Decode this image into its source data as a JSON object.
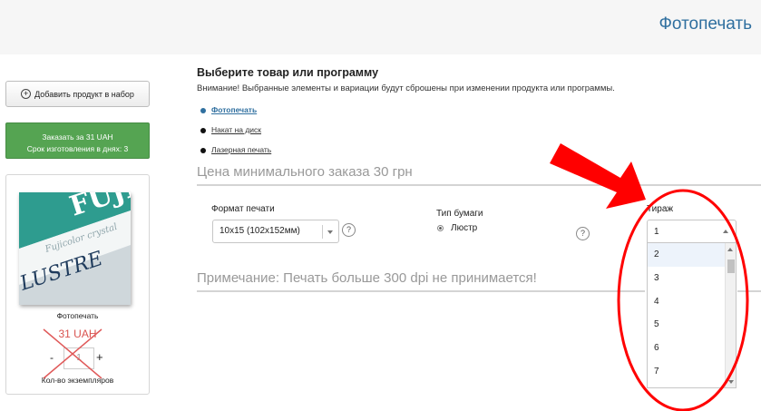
{
  "header": {
    "title": "Фотопечать"
  },
  "sidebar": {
    "add_product_label": "Добавить продукт в набор",
    "order": {
      "label": "Заказать за 31 UAH",
      "subtitle": "Срок изготовления в днях: 3"
    },
    "product": {
      "name": "Фотопечать",
      "price": "31 UAH",
      "quantity_value": "1",
      "quantity_minus": "-",
      "quantity_plus": "+",
      "quantity_label": "Кол-во экземпляров",
      "image_text": [
        "FUJI",
        "Fujicolor crystal",
        "LUSTRE"
      ]
    }
  },
  "main": {
    "heading": "Выберите товар или программу",
    "notice": "Внимание! Выбранные элементы и вариации будут сброшены при изменении продукта или программы.",
    "options": [
      {
        "label": "Фотопечать",
        "selected": true
      },
      {
        "label": "Накат на диск",
        "selected": false
      },
      {
        "label": "Лазерная печать",
        "selected": false
      }
    ],
    "min_order": "Цена минимального заказа 30 грн",
    "format": {
      "label": "Формат печати",
      "value": "10x15 (102x152мм)",
      "help": "?"
    },
    "paper": {
      "label": "Тип бумаги",
      "value": "Люстр",
      "help": "?"
    },
    "tirazh": {
      "label": "Тираж",
      "value": "1",
      "options": [
        "2",
        "3",
        "4",
        "5",
        "6",
        "7"
      ]
    },
    "note": "Примечание: Печать больше 300 dpi не принимается!"
  },
  "colors": {
    "accent_blue": "#2f6f9f",
    "order_green": "#55a452",
    "price_red": "#d9534f",
    "annotation_red": "#ff0000"
  }
}
